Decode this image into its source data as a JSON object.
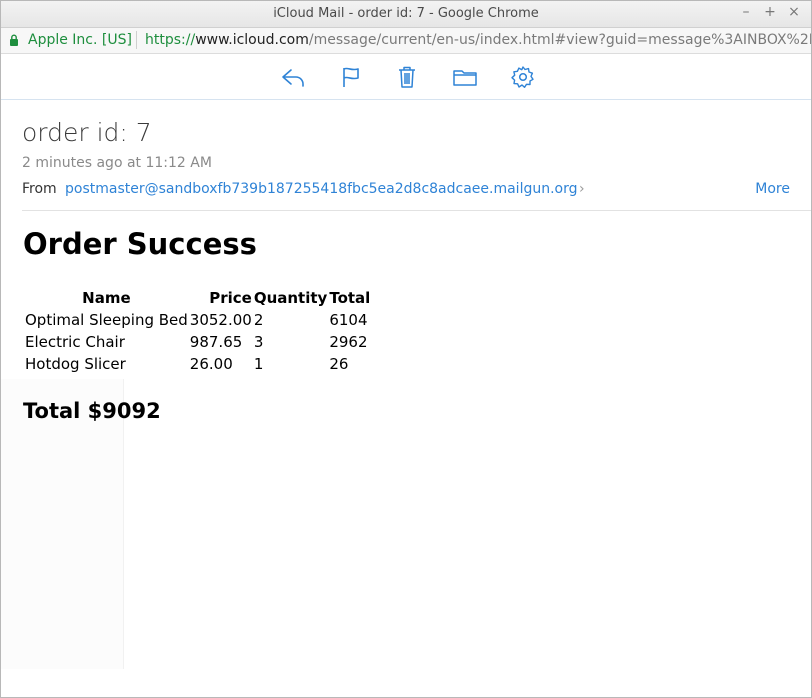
{
  "window": {
    "title": "iCloud Mail - order id: 7 - Google Chrome",
    "controls": {
      "minimize": "–",
      "maximize": "+",
      "close": "×"
    }
  },
  "address_bar": {
    "org": "Apple Inc. [US]",
    "scheme": "https://",
    "host": "www.icloud.com",
    "path": "/message/current/en-us/index.html#view?guid=message%3AINBOX%2F2..."
  },
  "toolbar": {
    "icons": [
      "reply-icon",
      "flag-icon",
      "trash-icon",
      "folder-icon",
      "gear-icon"
    ],
    "accent": "#2f83d6"
  },
  "message": {
    "subject": "order id: 7",
    "timestamp": "2 minutes ago at 11:12 AM",
    "from_label": "From",
    "from_address": "postmaster@sandboxfb739b187255418fbc5ea2d8c8adcaee.mailgun.org",
    "more_label": "More"
  },
  "order": {
    "title": "Order Success",
    "headers": {
      "name": "Name",
      "price": "Price",
      "quantity": "Quantity",
      "total": "Total"
    },
    "rows": [
      {
        "name": "Optimal Sleeping Bed",
        "price": "3052.00",
        "quantity": "2",
        "total": "6104"
      },
      {
        "name": "Electric Chair",
        "price": "987.65",
        "quantity": "3",
        "total": "2962"
      },
      {
        "name": "Hotdog Slicer",
        "price": "26.00",
        "quantity": "1",
        "total": "26"
      }
    ],
    "grand_total": "Total $9092"
  }
}
